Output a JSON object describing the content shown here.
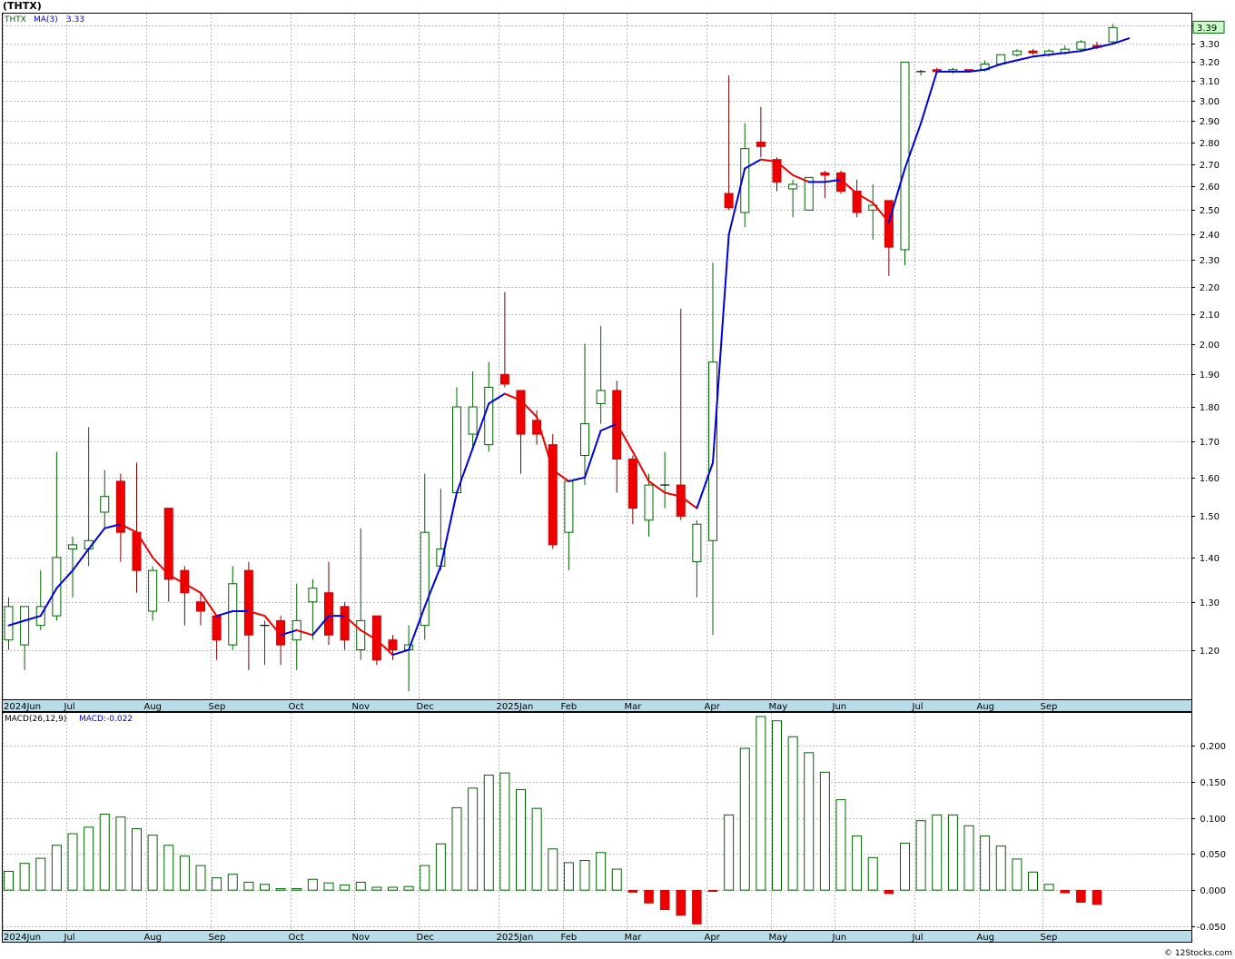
{
  "symbol_title": "(THTX)",
  "footer": "© 12Stocks.com",
  "colors": {
    "up": "#006400",
    "down": "#ee0000",
    "ma_up": "#0000dd",
    "ma_down": "#ee0000",
    "grid": "#b8b8b8",
    "axis_bar": "#b7dde8",
    "macd": "#006400"
  },
  "chart_data": [
    {
      "type": "candlestick",
      "title": "",
      "legend": {
        "symbol": "THTX",
        "ma_label": "MA(3)",
        "ma_value": "3.33"
      },
      "last_price_label": "3.39",
      "scale": "log",
      "ylim": [
        1.105,
        3.47
      ],
      "yticks": [
        1.2,
        1.3,
        1.4,
        1.5,
        1.6,
        1.7,
        1.8,
        1.9,
        2.0,
        2.1,
        2.2,
        2.3,
        2.4,
        2.5,
        2.6,
        2.7,
        2.8,
        2.9,
        3.0,
        3.1,
        3.2,
        3.3,
        3.4
      ],
      "x_labels": [
        "2024Jun",
        "Jul",
        "Aug",
        "Sep",
        "Oct",
        "Nov",
        "Dec",
        "2025Jan",
        "Feb",
        "Mar",
        "Apr",
        "May",
        "Jun",
        "Jul",
        "Aug",
        "Sep"
      ],
      "x_label_week": [
        0,
        4,
        9,
        13,
        18,
        22,
        26,
        31,
        35,
        39,
        44,
        48,
        52,
        57,
        61,
        65
      ],
      "candles": [
        {
          "o": 1.22,
          "h": 1.31,
          "l": 1.2,
          "c": 1.29
        },
        {
          "o": 1.21,
          "h": 1.29,
          "l": 1.16,
          "c": 1.29
        },
        {
          "o": 1.25,
          "h": 1.37,
          "l": 1.24,
          "c": 1.29
        },
        {
          "o": 1.27,
          "h": 1.67,
          "l": 1.26,
          "c": 1.4
        },
        {
          "o": 1.42,
          "h": 1.45,
          "l": 1.31,
          "c": 1.43
        },
        {
          "o": 1.42,
          "h": 1.74,
          "l": 1.38,
          "c": 1.44
        },
        {
          "o": 1.51,
          "h": 1.62,
          "l": 1.47,
          "c": 1.55
        },
        {
          "o": 1.59,
          "h": 1.61,
          "l": 1.39,
          "c": 1.46
        },
        {
          "o": 1.46,
          "h": 1.64,
          "l": 1.32,
          "c": 1.37
        },
        {
          "o": 1.28,
          "h": 1.38,
          "l": 1.26,
          "c": 1.37
        },
        {
          "o": 1.52,
          "h": 1.52,
          "l": 1.3,
          "c": 1.35
        },
        {
          "o": 1.37,
          "h": 1.38,
          "l": 1.25,
          "c": 1.32
        },
        {
          "o": 1.3,
          "h": 1.32,
          "l": 1.25,
          "c": 1.28
        },
        {
          "o": 1.27,
          "h": 1.27,
          "l": 1.18,
          "c": 1.22
        },
        {
          "o": 1.21,
          "h": 1.38,
          "l": 1.2,
          "c": 1.34
        },
        {
          "o": 1.37,
          "h": 1.39,
          "l": 1.16,
          "c": 1.23
        },
        {
          "o": 1.25,
          "h": 1.26,
          "l": 1.17,
          "c": 1.25
        },
        {
          "o": 1.26,
          "h": 1.27,
          "l": 1.17,
          "c": 1.21
        },
        {
          "o": 1.22,
          "h": 1.34,
          "l": 1.16,
          "c": 1.26
        },
        {
          "o": 1.3,
          "h": 1.35,
          "l": 1.22,
          "c": 1.33
        },
        {
          "o": 1.32,
          "h": 1.39,
          "l": 1.21,
          "c": 1.23
        },
        {
          "o": 1.29,
          "h": 1.3,
          "l": 1.2,
          "c": 1.22
        },
        {
          "o": 1.2,
          "h": 1.47,
          "l": 1.18,
          "c": 1.26
        },
        {
          "o": 1.27,
          "h": 1.27,
          "l": 1.17,
          "c": 1.18
        },
        {
          "o": 1.22,
          "h": 1.23,
          "l": 1.18,
          "c": 1.2
        },
        {
          "o": 1.2,
          "h": 1.25,
          "l": 1.12,
          "c": 1.21
        },
        {
          "o": 1.25,
          "h": 1.61,
          "l": 1.22,
          "c": 1.46
        },
        {
          "o": 1.38,
          "h": 1.57,
          "l": 1.37,
          "c": 1.42
        },
        {
          "o": 1.56,
          "h": 1.86,
          "l": 1.56,
          "c": 1.8
        },
        {
          "o": 1.72,
          "h": 1.91,
          "l": 1.68,
          "c": 1.8
        },
        {
          "o": 1.69,
          "h": 1.94,
          "l": 1.67,
          "c": 1.86
        },
        {
          "o": 1.9,
          "h": 2.18,
          "l": 1.86,
          "c": 1.87
        },
        {
          "o": 1.85,
          "h": 1.85,
          "l": 1.61,
          "c": 1.72
        },
        {
          "o": 1.76,
          "h": 1.79,
          "l": 1.69,
          "c": 1.72
        },
        {
          "o": 1.69,
          "h": 1.72,
          "l": 1.42,
          "c": 1.43
        },
        {
          "o": 1.46,
          "h": 1.58,
          "l": 1.37,
          "c": 1.59
        },
        {
          "o": 1.66,
          "h": 2.0,
          "l": 1.58,
          "c": 1.75
        },
        {
          "o": 1.81,
          "h": 2.06,
          "l": 1.75,
          "c": 1.85
        },
        {
          "o": 1.85,
          "h": 1.88,
          "l": 1.56,
          "c": 1.65
        },
        {
          "o": 1.65,
          "h": 1.66,
          "l": 1.48,
          "c": 1.52
        },
        {
          "o": 1.49,
          "h": 1.61,
          "l": 1.45,
          "c": 1.58
        },
        {
          "o": 1.58,
          "h": 1.67,
          "l": 1.52,
          "c": 1.58
        },
        {
          "o": 1.58,
          "h": 2.12,
          "l": 1.49,
          "c": 1.5
        },
        {
          "o": 1.39,
          "h": 1.49,
          "l": 1.31,
          "c": 1.48
        },
        {
          "o": 1.44,
          "h": 2.29,
          "l": 1.23,
          "c": 1.94
        },
        {
          "o": 2.57,
          "h": 3.13,
          "l": 2.5,
          "c": 2.51
        },
        {
          "o": 2.49,
          "h": 2.89,
          "l": 2.43,
          "c": 2.77
        },
        {
          "o": 2.8,
          "h": 2.97,
          "l": 2.73,
          "c": 2.78
        },
        {
          "o": 2.72,
          "h": 2.73,
          "l": 2.58,
          "c": 2.62
        },
        {
          "o": 2.59,
          "h": 2.63,
          "l": 2.47,
          "c": 2.61
        },
        {
          "o": 2.5,
          "h": 2.64,
          "l": 2.5,
          "c": 2.64
        },
        {
          "o": 2.66,
          "h": 2.67,
          "l": 2.55,
          "c": 2.65
        },
        {
          "o": 2.66,
          "h": 2.67,
          "l": 2.57,
          "c": 2.58
        },
        {
          "o": 2.58,
          "h": 2.63,
          "l": 2.47,
          "c": 2.49
        },
        {
          "o": 2.5,
          "h": 2.61,
          "l": 2.38,
          "c": 2.52
        },
        {
          "o": 2.54,
          "h": 2.54,
          "l": 2.24,
          "c": 2.35
        },
        {
          "o": 2.34,
          "h": 3.2,
          "l": 2.28,
          "c": 3.2
        },
        {
          "o": 3.15,
          "h": 3.16,
          "l": 3.13,
          "c": 3.15
        },
        {
          "o": 3.16,
          "h": 3.17,
          "l": 3.14,
          "c": 3.15
        },
        {
          "o": 3.15,
          "h": 3.17,
          "l": 3.14,
          "c": 3.16
        },
        {
          "o": 3.16,
          "h": 3.16,
          "l": 3.15,
          "c": 3.15
        },
        {
          "o": 3.16,
          "h": 3.21,
          "l": 3.15,
          "c": 3.19
        },
        {
          "o": 3.19,
          "h": 3.24,
          "l": 3.18,
          "c": 3.24
        },
        {
          "o": 3.24,
          "h": 3.27,
          "l": 3.23,
          "c": 3.26
        },
        {
          "o": 3.26,
          "h": 3.27,
          "l": 3.24,
          "c": 3.25
        },
        {
          "o": 3.24,
          "h": 3.27,
          "l": 3.23,
          "c": 3.26
        },
        {
          "o": 3.25,
          "h": 3.29,
          "l": 3.24,
          "c": 3.27
        },
        {
          "o": 3.27,
          "h": 3.32,
          "l": 3.26,
          "c": 3.31
        },
        {
          "o": 3.29,
          "h": 3.31,
          "l": 3.27,
          "c": 3.28
        },
        {
          "o": 3.31,
          "h": 3.41,
          "l": 3.3,
          "c": 3.39
        }
      ],
      "ma3": [
        1.25,
        1.26,
        1.27,
        1.33,
        1.37,
        1.42,
        1.47,
        1.48,
        1.46,
        1.4,
        1.36,
        1.34,
        1.32,
        1.27,
        1.28,
        1.28,
        1.27,
        1.23,
        1.24,
        1.23,
        1.27,
        1.27,
        1.24,
        1.22,
        1.19,
        1.2,
        1.29,
        1.38,
        1.56,
        1.68,
        1.81,
        1.84,
        1.82,
        1.77,
        1.62,
        1.59,
        1.6,
        1.73,
        1.75,
        1.67,
        1.59,
        1.56,
        1.55,
        1.52,
        1.64,
        2.4,
        2.68,
        2.72,
        2.71,
        2.65,
        2.62,
        2.62,
        2.63,
        2.57,
        2.53,
        2.45,
        2.68,
        2.89,
        3.15,
        3.15,
        3.15,
        3.16,
        3.19,
        3.21,
        3.23,
        3.24,
        3.25,
        3.26,
        3.28,
        3.3,
        3.33
      ]
    },
    {
      "type": "bar",
      "title": "",
      "legend": {
        "name": "MACD(26,12,9)",
        "value_label": "MACD:-0.022"
      },
      "ylim": [
        -0.055,
        0.245
      ],
      "yticks": [
        -0.05,
        0.0,
        0.05,
        0.1,
        0.15,
        0.2
      ],
      "ytick_labels": [
        "-0.050",
        "0.000",
        "0.050",
        "0.100",
        "0.150",
        "0.200"
      ],
      "x_labels": [
        "2024Jun",
        "Jul",
        "Aug",
        "Sep",
        "Oct",
        "Nov",
        "Dec",
        "2025Jan",
        "Feb",
        "Mar",
        "Apr",
        "May",
        "Jun",
        "Jul",
        "Aug",
        "Sep"
      ],
      "values": [
        0.026,
        0.037,
        0.044,
        0.062,
        0.078,
        0.087,
        0.105,
        0.101,
        0.085,
        0.076,
        0.062,
        0.047,
        0.034,
        0.017,
        0.022,
        0.011,
        0.008,
        0.002,
        0.002,
        0.015,
        0.01,
        0.007,
        0.011,
        0.004,
        0.004,
        0.005,
        0.034,
        0.064,
        0.114,
        0.141,
        0.159,
        0.162,
        0.139,
        0.113,
        0.057,
        0.038,
        0.041,
        0.052,
        0.029,
        -0.003,
        -0.018,
        -0.027,
        -0.035,
        -0.047,
        -0.002,
        0.104,
        0.196,
        0.24,
        0.234,
        0.212,
        0.19,
        0.163,
        0.125,
        0.075,
        0.045,
        -0.005,
        0.065,
        0.096,
        0.104,
        0.104,
        0.089,
        0.075,
        0.061,
        0.043,
        0.025,
        0.008,
        -0.004,
        -0.017,
        -0.02
      ]
    }
  ]
}
